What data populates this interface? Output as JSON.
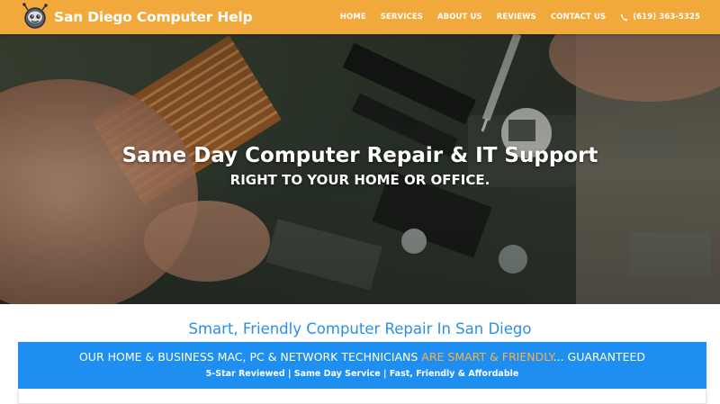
{
  "header": {
    "brand": "San Diego Computer Help",
    "logo_icon": "robot-mascot-icon",
    "nav": [
      "HOME",
      "SERVICES",
      "ABOUT US",
      "REVIEWS",
      "CONTACT US"
    ],
    "phone": "(619) 363-5325",
    "phone_icon": "phone-icon"
  },
  "hero": {
    "title": "Same Day Computer Repair & IT Support",
    "subtitle": "RIGHT TO YOUR HOME OR OFFICE."
  },
  "main": {
    "section_title": "Smart, Friendly Computer Repair In San Diego",
    "banner": {
      "line1_part1": "OUR HOME & BUSINESS MAC, PC & NETWORK TECHNICIANS ",
      "line1_highlight": "ARE SMART & FRIENDLY",
      "line1_part2": "... GUARANTEED",
      "line2": "5-Star Reviewed | Same Day Service | Fast, Friendly & Affordable"
    }
  },
  "colors": {
    "header_bg": "#f2a93b",
    "accent_blue": "#1e8ff0",
    "title_blue": "#2b8fe6",
    "highlight_orange": "#f6b24a"
  }
}
